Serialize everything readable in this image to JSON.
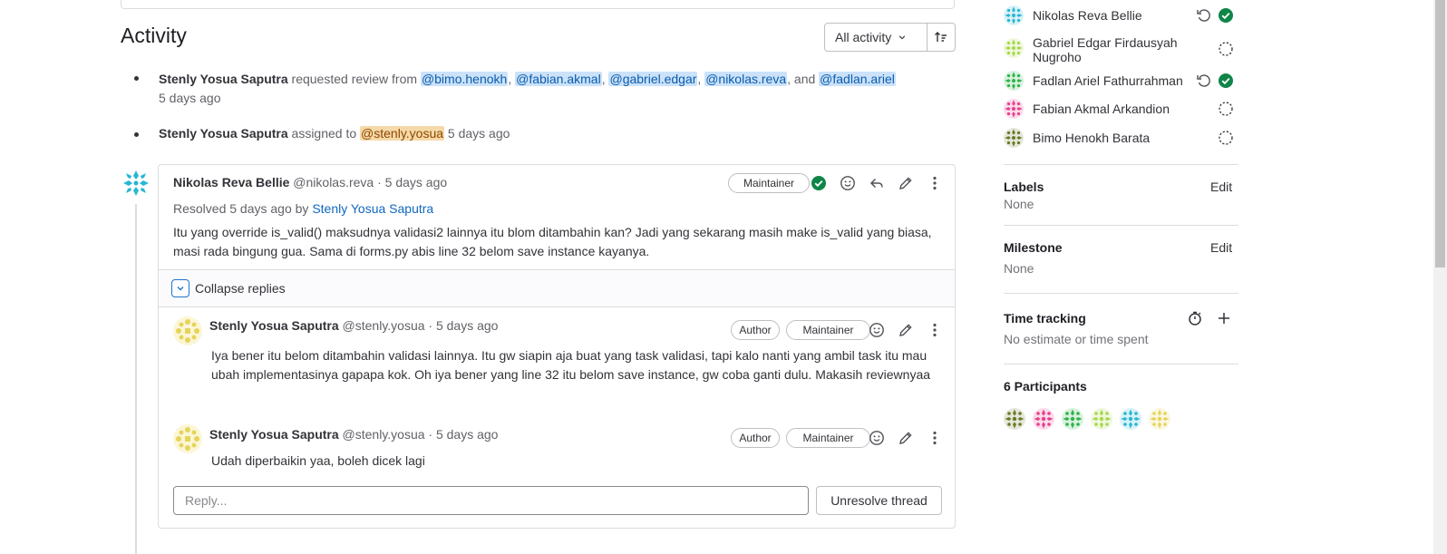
{
  "activity": {
    "title": "Activity",
    "filter_label": "All activity"
  },
  "system_notes": [
    {
      "author": "Stenly Yosua Saputra",
      "text": "requested review from",
      "mentions": [
        "@bimo.henokh",
        "@fabian.akmal",
        "@gabriel.edgar",
        "@nikolas.reva",
        "@fadlan.ariel"
      ],
      "sep": ",",
      "and": ", and",
      "time": "5 days ago"
    },
    {
      "author": "Stenly Yosua Saputra",
      "text": "assigned to",
      "mention": "@stenly.yosua",
      "time": "5 days ago"
    }
  ],
  "thread": {
    "main": {
      "author": "Nikolas Reva Bellie",
      "handle": "@nikolas.reva",
      "time": "· 5 days ago",
      "badge": "Maintainer",
      "resolved_prefix": "Resolved 5 days ago by",
      "resolved_by": "Stenly Yosua Saputra",
      "body": "Itu yang override is_valid() maksudnya validasi2 lainnya itu blom ditambahin kan? Jadi yang sekarang masih make is_valid yang biasa, masi rada bingung gua. Sama di forms.py abis line 32 belom save instance kayanya."
    },
    "collapse_label": "Collapse replies",
    "replies": [
      {
        "author": "Stenly Yosua Saputra",
        "handle": "@stenly.yosua",
        "time": "· 5 days ago",
        "badge1": "Author",
        "badge2": "Maintainer",
        "body": "Iya bener itu belom ditambahin validasi lainnya. Itu gw siapin aja buat yang task validasi, tapi kalo nanti yang ambil task itu mau ubah implementasinya gapapa kok. Oh iya bener yang line 32 itu belom save instance, gw coba ganti dulu. Makasih reviewnyaa"
      },
      {
        "author": "Stenly Yosua Saputra",
        "handle": "@stenly.yosua",
        "time": "· 5 days ago",
        "badge1": "Author",
        "badge2": "Maintainer",
        "body": "Udah diperbaikin yaa, boleh dicek lagi"
      }
    ],
    "reply_placeholder": "Reply...",
    "unresolve_label": "Unresolve thread"
  },
  "sidebar": {
    "reviewers": [
      {
        "name": "Nikolas Reva Bellie",
        "status": "approved",
        "rerequest": true,
        "color": "#29b6d4"
      },
      {
        "name": "Gabriel Edgar Firdausyah Nugroho",
        "status": "pending",
        "rerequest": false,
        "color": "#a6d84a"
      },
      {
        "name": "Fadlan Ariel Fathurrahman",
        "status": "approved",
        "rerequest": true,
        "color": "#2fb34a"
      },
      {
        "name": "Fabian Akmal Arkandion",
        "status": "pending",
        "rerequest": false,
        "color": "#e83e8c"
      },
      {
        "name": "Bimo Henokh Barata",
        "status": "pending",
        "rerequest": false,
        "color": "#6b7a2a"
      }
    ],
    "labels": {
      "title": "Labels",
      "edit": "Edit",
      "value": "None"
    },
    "milestone": {
      "title": "Milestone",
      "edit": "Edit",
      "value": "None"
    },
    "time_tracking": {
      "title": "Time tracking",
      "value": "No estimate or time spent"
    },
    "participants": {
      "title": "6 Participants",
      "colors": [
        "#6b7a2a",
        "#e83e8c",
        "#2fb34a",
        "#a6d84a",
        "#29b6d4",
        "#e6d35a"
      ]
    }
  },
  "colors": {
    "approved": "#108548",
    "link": "#1068bf",
    "mention_bg": "#cbe2f9"
  }
}
